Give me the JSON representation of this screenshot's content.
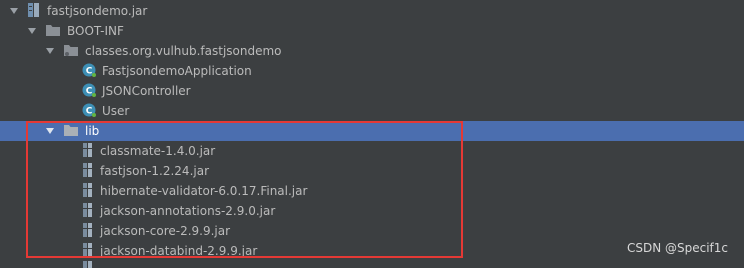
{
  "tree": {
    "items": [
      {
        "label": "fastjsondemo.jar",
        "icon": "jar-archive-icon",
        "expanded": true
      },
      {
        "label": "BOOT-INF",
        "icon": "folder-icon",
        "expanded": true
      },
      {
        "label": "classes.org.vulhub.fastjsondemo",
        "icon": "package-folder-icon",
        "expanded": true
      },
      {
        "label": "FastjsondemoApplication",
        "icon": "class-icon"
      },
      {
        "label": "JSONController",
        "icon": "class-icon"
      },
      {
        "label": "User",
        "icon": "class-icon"
      },
      {
        "label": "lib",
        "icon": "folder-icon",
        "expanded": true,
        "selected": true
      },
      {
        "label": "classmate-1.4.0.jar",
        "icon": "jar-library-icon"
      },
      {
        "label": "fastjson-1.2.24.jar",
        "icon": "jar-library-icon"
      },
      {
        "label": "hibernate-validator-6.0.17.Final.jar",
        "icon": "jar-library-icon"
      },
      {
        "label": "jackson-annotations-2.9.0.jar",
        "icon": "jar-library-icon"
      },
      {
        "label": "jackson-core-2.9.9.jar",
        "icon": "jar-library-icon"
      },
      {
        "label": "jackson-databind-2.9.9.jar",
        "icon": "jar-library-icon"
      }
    ]
  },
  "watermark": "CSDN @Specif1c",
  "colors": {
    "background": "#3c3f41",
    "selected_row": "#4b6eaf",
    "highlight_border": "#e53935",
    "class_icon": "#3d8fb5"
  }
}
